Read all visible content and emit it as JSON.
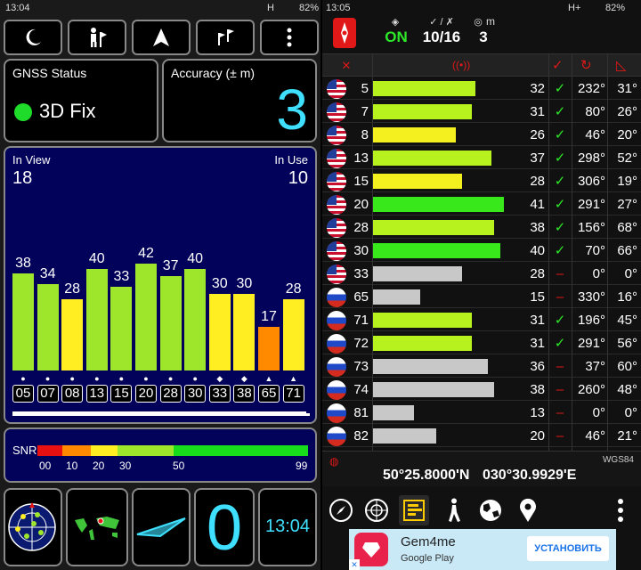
{
  "left_status": {
    "time": "13:04",
    "battery": "82%",
    "network": "H"
  },
  "right_status": {
    "time": "13:05",
    "battery": "82%",
    "network": "H+"
  },
  "gnss": {
    "label": "GNSS Status",
    "fix": "3D Fix",
    "fix_color": "#1fdc2a"
  },
  "accuracy": {
    "label": "Accuracy (± m)",
    "value": "3",
    "value_color": "#3fe0ff"
  },
  "inview": {
    "label": "In View",
    "value": "18"
  },
  "inuse": {
    "label": "In Use",
    "value": "10"
  },
  "chart_data": {
    "type": "bar",
    "categories": [
      "05",
      "07",
      "08",
      "13",
      "15",
      "20",
      "28",
      "30",
      "33",
      "38",
      "65",
      "71"
    ],
    "values": [
      38,
      34,
      28,
      40,
      33,
      42,
      37,
      40,
      30,
      30,
      17,
      28
    ],
    "colors": [
      "#9de62b",
      "#9de62b",
      "#ffee22",
      "#9de62b",
      "#9de62b",
      "#9de62b",
      "#9de62b",
      "#9de62b",
      "#ffee22",
      "#ffee22",
      "#ff8a00",
      "#ffee22"
    ],
    "markers": [
      "circle",
      "circle",
      "circle",
      "circle",
      "circle",
      "circle",
      "circle",
      "circle",
      "diamond",
      "diamond",
      "triangle",
      "triangle"
    ],
    "ylim": [
      0,
      60
    ]
  },
  "snr": {
    "label": "SNR",
    "ticks": [
      "00",
      "10",
      "20",
      "30",
      "50",
      "99"
    ]
  },
  "clock": {
    "value": "13:04"
  },
  "speed": {
    "value": "0"
  },
  "header": {
    "on_label": "ON",
    "sat_count": "10/16",
    "accuracy_value": "3",
    "accuracy_unit": "m"
  },
  "sat_rows": [
    {
      "flag": "usa",
      "prn": "5",
      "snr": 32,
      "used": true,
      "az": "232°",
      "el": "31°",
      "color": "#b8f21e"
    },
    {
      "flag": "usa",
      "prn": "7",
      "snr": 31,
      "used": true,
      "az": "80°",
      "el": "26°",
      "color": "#b8f21e"
    },
    {
      "flag": "usa",
      "prn": "8",
      "snr": 26,
      "used": true,
      "az": "46°",
      "el": "20°",
      "color": "#f4f020"
    },
    {
      "flag": "usa",
      "prn": "13",
      "snr": 37,
      "used": true,
      "az": "298°",
      "el": "52°",
      "color": "#b8f21e"
    },
    {
      "flag": "usa",
      "prn": "15",
      "snr": 28,
      "used": true,
      "az": "306°",
      "el": "19°",
      "color": "#f4f020"
    },
    {
      "flag": "usa",
      "prn": "20",
      "snr": 41,
      "used": true,
      "az": "291°",
      "el": "27°",
      "color": "#38e81a"
    },
    {
      "flag": "usa",
      "prn": "28",
      "snr": 38,
      "used": true,
      "az": "156°",
      "el": "68°",
      "color": "#b8f21e"
    },
    {
      "flag": "usa",
      "prn": "30",
      "snr": 40,
      "used": true,
      "az": "70°",
      "el": "66°",
      "color": "#38e81a"
    },
    {
      "flag": "usa",
      "prn": "33",
      "snr": 28,
      "used": false,
      "az": "0°",
      "el": "0°",
      "color": "#c8c8c8"
    },
    {
      "flag": "rus",
      "prn": "65",
      "snr": 15,
      "used": false,
      "az": "330°",
      "el": "16°",
      "color": "#c8c8c8"
    },
    {
      "flag": "rus",
      "prn": "71",
      "snr": 31,
      "used": true,
      "az": "196°",
      "el": "45°",
      "color": "#b8f21e"
    },
    {
      "flag": "rus",
      "prn": "72",
      "snr": 31,
      "used": true,
      "az": "291°",
      "el": "56°",
      "color": "#b8f21e"
    },
    {
      "flag": "rus",
      "prn": "73",
      "snr": 36,
      "used": false,
      "az": "37°",
      "el": "60°",
      "color": "#c8c8c8"
    },
    {
      "flag": "rus",
      "prn": "74",
      "snr": 38,
      "used": false,
      "az": "260°",
      "el": "48°",
      "color": "#c8c8c8"
    },
    {
      "flag": "rus",
      "prn": "81",
      "snr": 13,
      "used": false,
      "az": "0°",
      "el": "0°",
      "color": "#c8c8c8"
    },
    {
      "flag": "rus",
      "prn": "82",
      "snr": 20,
      "used": false,
      "az": "46°",
      "el": "21°",
      "color": "#c8c8c8"
    }
  ],
  "position": {
    "lat": "50°25.8000'N",
    "lon": "030°30.9929'E",
    "datum": "WGS84"
  },
  "ad": {
    "title": "Gem4me",
    "store": "Google Play",
    "button": "УСТАНОВИТЬ"
  },
  "icons": [
    "moon-icon",
    "hiker-icon",
    "navigation-arrow-icon",
    "flags-icon",
    "menu-dots-icon",
    "compass-icon",
    "sky-view-icon",
    "signal-bars-icon",
    "walker-icon",
    "globe-icon",
    "map-pin-icon"
  ]
}
